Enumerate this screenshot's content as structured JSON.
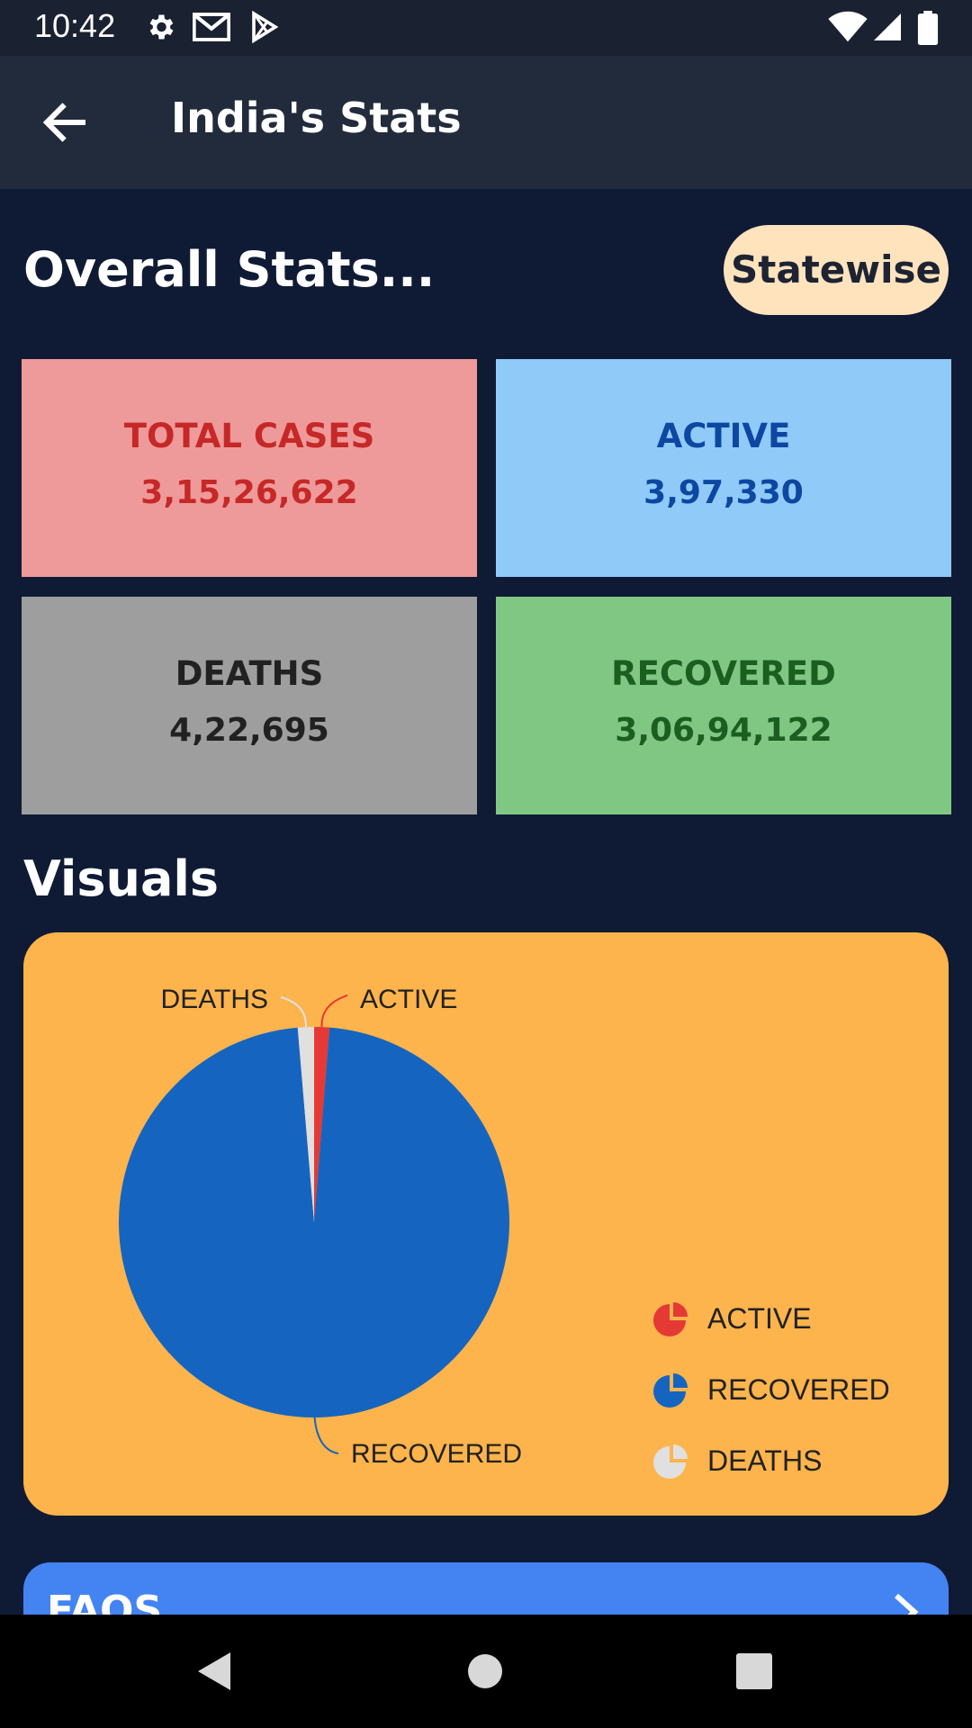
{
  "status_bar": {
    "time": "10:42",
    "left_icons": [
      "gear-icon",
      "gmail-icon",
      "play-store-icon"
    ],
    "right_icons": [
      "wifi-icon",
      "signal-icon",
      "battery-icon"
    ]
  },
  "app_bar": {
    "title": "India's Stats",
    "back_icon": "arrow-back-icon"
  },
  "overall": {
    "heading": "Overall Stats...",
    "statewise_button": "Statewise"
  },
  "stats": [
    {
      "key": "total",
      "label": "TOTAL CASES",
      "value": "3,15,26,622",
      "bg": "#ef9a9a",
      "fg": "#c62828"
    },
    {
      "key": "active",
      "label": "ACTIVE",
      "value": "3,97,330",
      "bg": "#90caf9",
      "fg": "#0d47a1"
    },
    {
      "key": "deaths",
      "label": "DEATHS",
      "value": "4,22,695",
      "bg": "#9e9e9e",
      "fg": "#212121"
    },
    {
      "key": "recovered",
      "label": "RECOVERED",
      "value": "3,06,94,122",
      "bg": "#81c784",
      "fg": "#1b5e20"
    }
  ],
  "visuals": {
    "heading": "Visuals",
    "card_bg": "#feb44c",
    "chart_data": {
      "type": "pie",
      "slices": [
        {
          "label": "ACTIVE",
          "value": 397330,
          "color": "#e53935"
        },
        {
          "label": "RECOVERED",
          "value": 30694122,
          "color": "#1565c0"
        },
        {
          "label": "DEATHS",
          "value": 422695,
          "color": "#e0e0e0"
        }
      ],
      "legend": [
        "ACTIVE",
        "RECOVERED",
        "DEATHS"
      ],
      "legend_position": "right"
    }
  },
  "faqs": {
    "label": "FAQS",
    "icon": "chevron-right-icon"
  },
  "nav_bar": {
    "buttons": [
      "back-triangle-icon",
      "home-circle-icon",
      "recents-square-icon"
    ]
  }
}
